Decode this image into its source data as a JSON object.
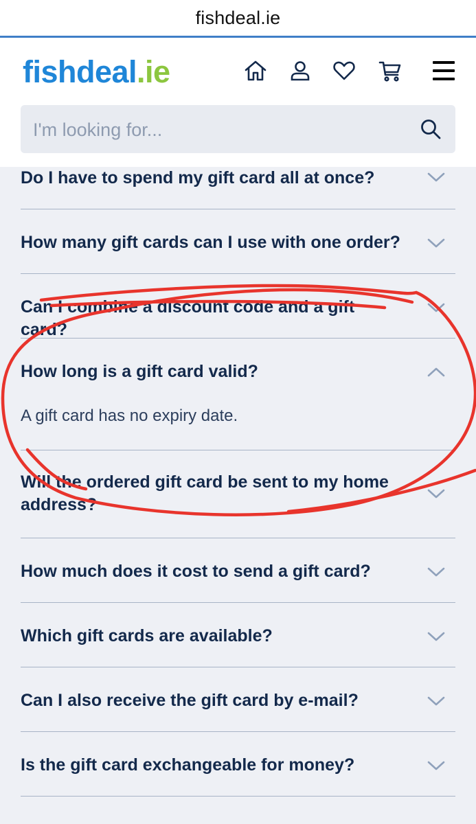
{
  "browser": {
    "url": "fishdeal.ie"
  },
  "header": {
    "logo_main": "fishdeal",
    "logo_tld": ".ie",
    "icons": [
      "home-icon",
      "account-icon",
      "wishlist-icon",
      "cart-icon",
      "menu-icon"
    ]
  },
  "search": {
    "placeholder": "I'm looking for...",
    "value": ""
  },
  "faq": {
    "items": [
      {
        "question": "Do I have to spend my gift card all at once?",
        "expanded": false
      },
      {
        "question": "How many gift cards can I use with one order?",
        "expanded": false
      },
      {
        "question": "Can I combine a discount code and a gift card?",
        "expanded": false
      },
      {
        "question": "How long is a gift card valid?",
        "expanded": true,
        "answer": "A gift card has no expiry date."
      },
      {
        "question": "Will the ordered gift card be sent to my home address?",
        "expanded": false
      },
      {
        "question": "How much does it cost to send a gift card?",
        "expanded": false
      },
      {
        "question": "Which gift cards are available?",
        "expanded": false
      },
      {
        "question": "Can I also receive the gift card by e-mail?",
        "expanded": false
      },
      {
        "question": "Is the gift card exchangeable for money?",
        "expanded": false
      }
    ]
  },
  "colors": {
    "brand_blue": "#1f86d8",
    "brand_green": "#8cc63f",
    "text_navy": "#13294b",
    "annotation_red": "#e8342c"
  }
}
